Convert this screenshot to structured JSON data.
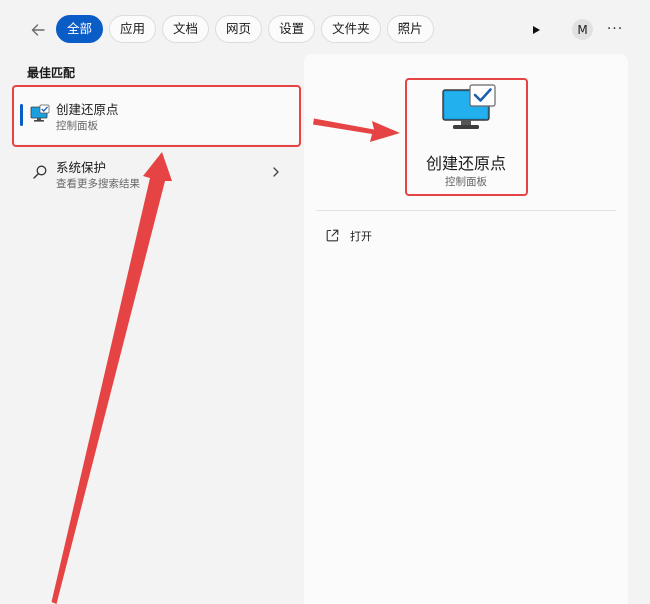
{
  "topbar": {
    "back_icon": "arrow-left-icon",
    "tabs": [
      {
        "label": "全部",
        "active": true
      },
      {
        "label": "应用",
        "active": false
      },
      {
        "label": "文档",
        "active": false
      },
      {
        "label": "网页",
        "active": false
      },
      {
        "label": "设置",
        "active": false
      },
      {
        "label": "文件夹",
        "active": false
      },
      {
        "label": "照片",
        "active": false
      }
    ],
    "avatar_letter": "M",
    "more_label": "···"
  },
  "results": {
    "section_title": "最佳匹配",
    "best": {
      "title": "创建还原点",
      "subtitle": "控制面板"
    },
    "other": {
      "title": "系统保护",
      "subtitle": "查看更多搜索结果"
    }
  },
  "detail": {
    "title": "创建还原点",
    "subtitle": "控制面板",
    "actions": [
      {
        "label": "打开",
        "icon": "open-external-icon"
      }
    ]
  },
  "colors": {
    "accent": "#0a5cc7",
    "annotation": "#e64444"
  }
}
